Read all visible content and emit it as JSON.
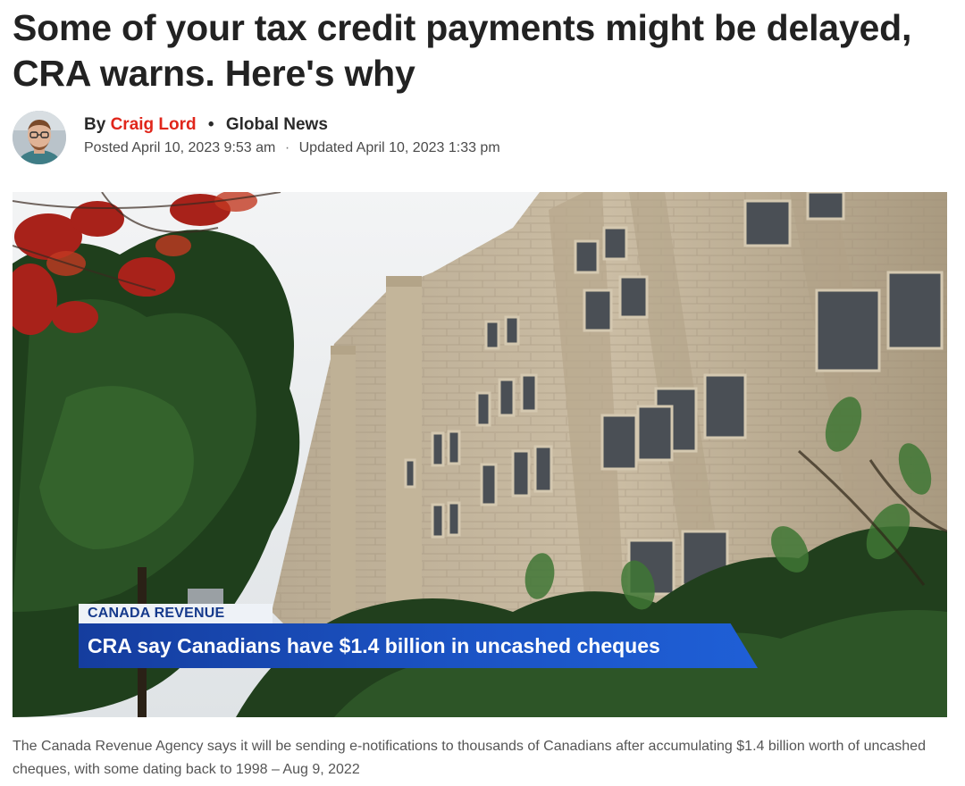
{
  "article": {
    "headline": "Some of your tax credit payments might be delayed, CRA warns. Here's why",
    "byline": {
      "prefix": "By",
      "author": "Craig Lord",
      "separator": "•",
      "outlet": "Global News",
      "posted": "Posted April 10, 2023 9:53 am",
      "date_separator": "·",
      "updated": "Updated April 10, 2023 1:33 pm"
    },
    "hero": {
      "tag": "CANADA REVENUE",
      "headline": "CRA say Canadians have $1.4 billion in uncashed cheques"
    },
    "caption": "The Canada Revenue Agency says it will be sending e-notifications to thousands of Canadians after accumulating $1.4 billion worth of uncashed cheques, with some dating back to 1998 – Aug 9, 2022"
  },
  "colors": {
    "author_link": "#e0261b",
    "lower_third_blue": "#1b53c4",
    "text_dark": "#222222",
    "text_muted": "#555555"
  },
  "icons": {
    "author_avatar": "author-avatar-photo"
  }
}
